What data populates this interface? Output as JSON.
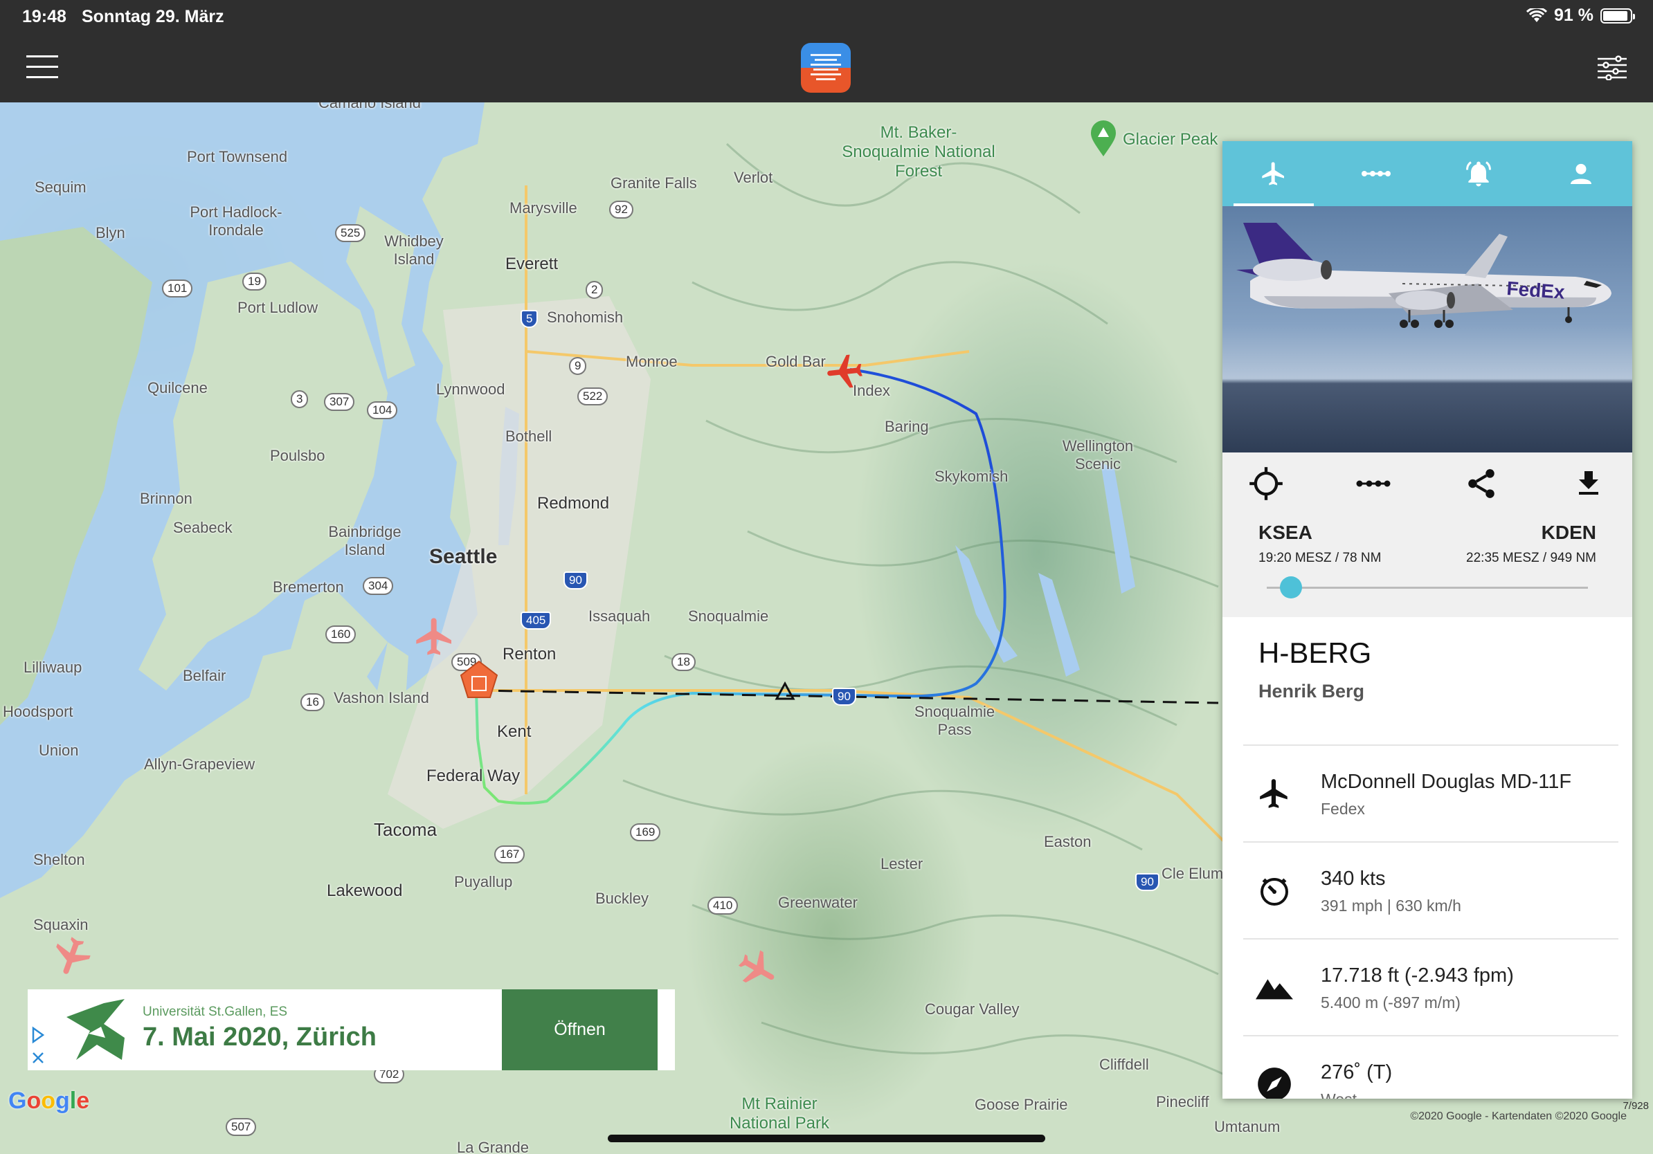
{
  "status": {
    "time": "19:48",
    "date": "Sonntag 29. März",
    "battery": "91 %",
    "battery_level": 0.91
  },
  "map": {
    "places": [
      {
        "name": "Camano Island",
        "kind": "normal"
      },
      {
        "name": "Port Townsend",
        "kind": "normal"
      },
      {
        "name": "Sequim",
        "kind": "normal"
      },
      {
        "name": "Blyn",
        "kind": "normal"
      },
      {
        "name": "Port Hadlock-Irondale",
        "kind": "normal"
      },
      {
        "name": "Whidbey Island",
        "kind": "normal"
      },
      {
        "name": "Granite Falls",
        "kind": "normal"
      },
      {
        "name": "Verlot",
        "kind": "normal"
      },
      {
        "name": "Mt. Baker-Snoqualmie National Forest",
        "kind": "park"
      },
      {
        "name": "Glacier Peak",
        "kind": "park"
      },
      {
        "name": "Marysville",
        "kind": "normal"
      },
      {
        "name": "Everett",
        "kind": "normal"
      },
      {
        "name": "Port Ludlow",
        "kind": "normal"
      },
      {
        "name": "Snohomish",
        "kind": "normal"
      },
      {
        "name": "Monroe",
        "kind": "normal"
      },
      {
        "name": "Gold Bar",
        "kind": "normal"
      },
      {
        "name": "Index",
        "kind": "normal"
      },
      {
        "name": "Quilcene",
        "kind": "normal"
      },
      {
        "name": "Lynnwood",
        "kind": "normal"
      },
      {
        "name": "Baring",
        "kind": "normal"
      },
      {
        "name": "Bothell",
        "kind": "normal"
      },
      {
        "name": "Poulsbo",
        "kind": "normal"
      },
      {
        "name": "Wellington Scenic",
        "kind": "normal"
      },
      {
        "name": "Skykomish",
        "kind": "normal"
      },
      {
        "name": "Redmond",
        "kind": "normal"
      },
      {
        "name": "Brinnon",
        "kind": "normal"
      },
      {
        "name": "Seabeck",
        "kind": "normal"
      },
      {
        "name": "Bainbridge Island",
        "kind": "normal"
      },
      {
        "name": "Seattle",
        "kind": "big"
      },
      {
        "name": "Bremerton",
        "kind": "normal"
      },
      {
        "name": "Issaquah",
        "kind": "normal"
      },
      {
        "name": "Snoqualmie",
        "kind": "normal"
      },
      {
        "name": "Lilliwaup",
        "kind": "normal"
      },
      {
        "name": "Belfair",
        "kind": "normal"
      },
      {
        "name": "Renton",
        "kind": "normal"
      },
      {
        "name": "Vashon Island",
        "kind": "normal"
      },
      {
        "name": "Hoodsport",
        "kind": "normal"
      },
      {
        "name": "Kent",
        "kind": "normal"
      },
      {
        "name": "Snoqualmie Pass",
        "kind": "normal"
      },
      {
        "name": "Union",
        "kind": "normal"
      },
      {
        "name": "Allyn-Grapeview",
        "kind": "normal"
      },
      {
        "name": "Federal Way",
        "kind": "normal"
      },
      {
        "name": "Tacoma",
        "kind": "big"
      },
      {
        "name": "Easton",
        "kind": "normal"
      },
      {
        "name": "Shelton",
        "kind": "normal"
      },
      {
        "name": "Lester",
        "kind": "normal"
      },
      {
        "name": "Cle Elum",
        "kind": "normal"
      },
      {
        "name": "Lakewood",
        "kind": "normal"
      },
      {
        "name": "Puyallup",
        "kind": "normal"
      },
      {
        "name": "Buckley",
        "kind": "normal"
      },
      {
        "name": "Greenwater",
        "kind": "normal"
      },
      {
        "name": "Squaxin",
        "kind": "normal"
      },
      {
        "name": "Cougar Valley",
        "kind": "normal"
      },
      {
        "name": "Cliffdell",
        "kind": "normal"
      },
      {
        "name": "Pinecliff",
        "kind": "normal"
      },
      {
        "name": "Goose Prairie",
        "kind": "normal"
      },
      {
        "name": "Mt Rainier National Park",
        "kind": "park"
      },
      {
        "name": "Umtanum",
        "kind": "normal"
      },
      {
        "name": "La Grande",
        "kind": "normal"
      }
    ],
    "shields": [
      {
        "num": "525",
        "type": "state"
      },
      {
        "num": "92",
        "type": "state"
      },
      {
        "num": "101",
        "type": "us"
      },
      {
        "num": "19",
        "type": "state"
      },
      {
        "num": "2",
        "type": "us"
      },
      {
        "num": "5",
        "type": "interstate"
      },
      {
        "num": "9",
        "type": "state"
      },
      {
        "num": "522",
        "type": "state"
      },
      {
        "num": "3",
        "type": "state"
      },
      {
        "num": "307",
        "type": "state"
      },
      {
        "num": "104",
        "type": "state"
      },
      {
        "num": "90",
        "type": "interstate"
      },
      {
        "num": "405",
        "type": "interstate"
      },
      {
        "num": "304",
        "type": "state"
      },
      {
        "num": "160",
        "type": "state"
      },
      {
        "num": "509",
        "type": "state"
      },
      {
        "num": "18",
        "type": "state"
      },
      {
        "num": "16",
        "type": "state"
      },
      {
        "num": "167",
        "type": "state"
      },
      {
        "num": "169",
        "type": "state"
      },
      {
        "num": "410",
        "type": "state"
      },
      {
        "num": "702",
        "type": "state"
      },
      {
        "num": "507",
        "type": "state"
      }
    ],
    "copyright": "©2020 Google - Kartendaten ©2020 Google",
    "scale_text": "7/928",
    "google_logo": "Google"
  },
  "panel": {
    "tabs": [
      {
        "name": "flight",
        "icon": "airplane-icon"
      },
      {
        "name": "route",
        "icon": "route-dots-icon"
      },
      {
        "name": "alerts",
        "icon": "bell-icon"
      },
      {
        "name": "profile",
        "icon": "person-icon"
      }
    ],
    "active_tab": 0,
    "route_actions": [
      "locate-icon",
      "route-dots-icon",
      "share-icon",
      "download-icon"
    ],
    "origin": {
      "code": "KSEA",
      "detail": "19:20 MESZ / 78 NM"
    },
    "destination": {
      "code": "KDEN",
      "detail": "22:35 MESZ / 949 NM"
    },
    "progress": 0.076,
    "callsign": "H-BERG",
    "pilot": "Henrik Berg",
    "rows": [
      {
        "icon": "airplane-icon",
        "main": "McDonnell Douglas MD-11F",
        "sub": "Fedex"
      },
      {
        "icon": "speed-icon",
        "main": "340 kts",
        "sub": "391 mph | 630 km/h"
      },
      {
        "icon": "mountain-icon",
        "main": "17.718 ft (-2.943 fpm)",
        "sub": "5.400 m (-897 m/m)"
      },
      {
        "icon": "compass-icon",
        "main": "276˚ (T)",
        "sub": "West"
      }
    ],
    "aircraft_livery": "FedEx"
  },
  "ad": {
    "source": "Universität St.Gallen, ES",
    "title": "7. Mai 2020, Zürich",
    "button": "Öffnen"
  }
}
